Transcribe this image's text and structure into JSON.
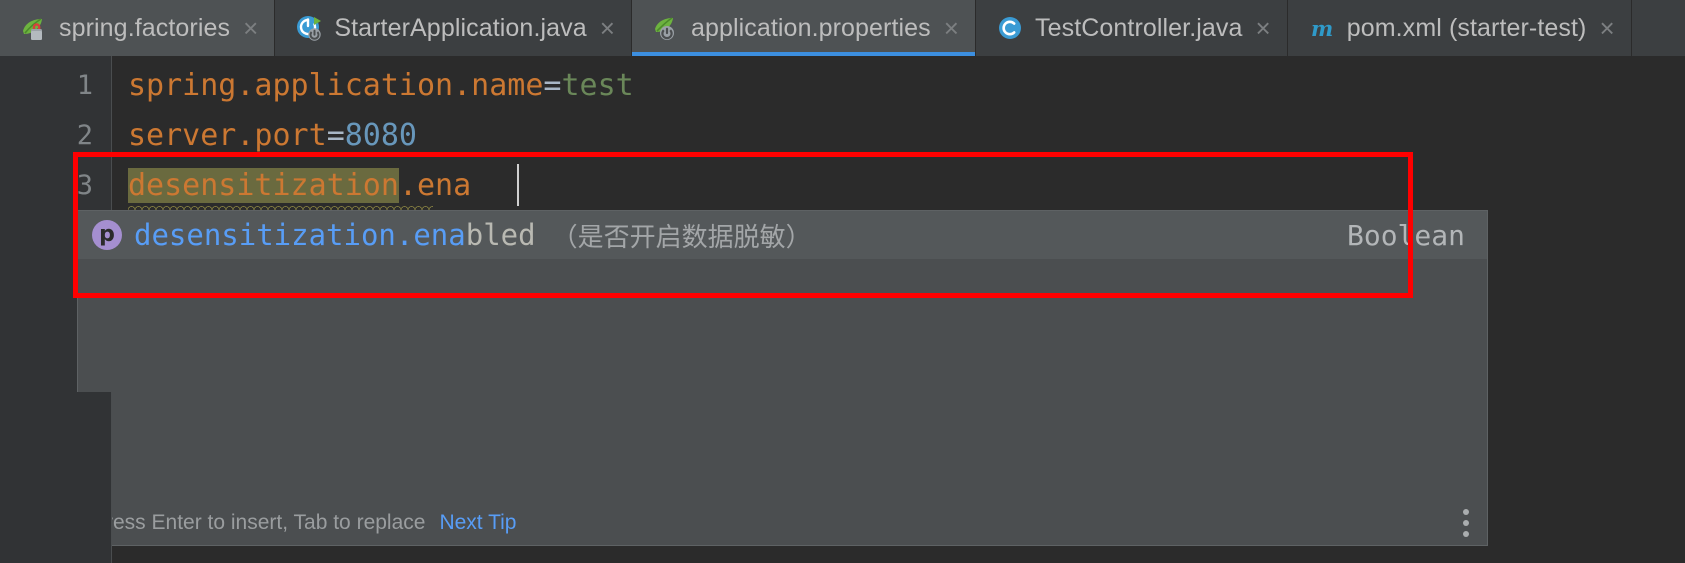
{
  "window": {
    "app": "IntelliJ IDEA",
    "theme_bg": "#2b2b2b",
    "accent": "#3c8fe0",
    "annotation_color": "#ff0000"
  },
  "tabs": [
    {
      "label": "spring.factories",
      "icon": "spring-factories-icon",
      "selected": false,
      "close_glyph": "×"
    },
    {
      "label": "StarterApplication.java",
      "icon": "spring-boot-class-icon",
      "selected": false,
      "close_glyph": "×"
    },
    {
      "label": "application.properties",
      "icon": "spring-properties-icon",
      "selected": true,
      "close_glyph": "×"
    },
    {
      "label": "TestController.java",
      "icon": "java-class-icon",
      "selected": false,
      "close_glyph": "×"
    },
    {
      "label": "pom.xml (starter-test)",
      "icon": "maven-icon",
      "selected": false,
      "close_glyph": "×"
    }
  ],
  "editor": {
    "gutter_lines": [
      "1",
      "2",
      "3"
    ],
    "lines": [
      {
        "n": "1",
        "key": "spring.application.name",
        "sep": "=",
        "value": "test",
        "value_type": "string"
      },
      {
        "n": "2",
        "key": "server.port",
        "sep": "=",
        "value": "8080",
        "value_type": "number"
      },
      {
        "n": "3",
        "key": "desensitization",
        "sep": ".",
        "value": "ena",
        "value_type": "typing"
      }
    ],
    "line3_full_text": "desensitization.ena",
    "line3_error_token": "desensitization",
    "caret_after": "desensitization.ena"
  },
  "completion_popup": {
    "items": [
      {
        "icon_letter": "p",
        "icon_name": "property-icon",
        "matched_prefix": "desensitization.ena",
        "remainder": "bled",
        "description": "（是否开启数据脱敏）",
        "type": "Boolean",
        "selected": true
      }
    ],
    "footer": {
      "hint": "Press Enter to insert, Tab to replace",
      "link": "Next Tip",
      "menu_icon": "kebab-menu-icon"
    }
  }
}
